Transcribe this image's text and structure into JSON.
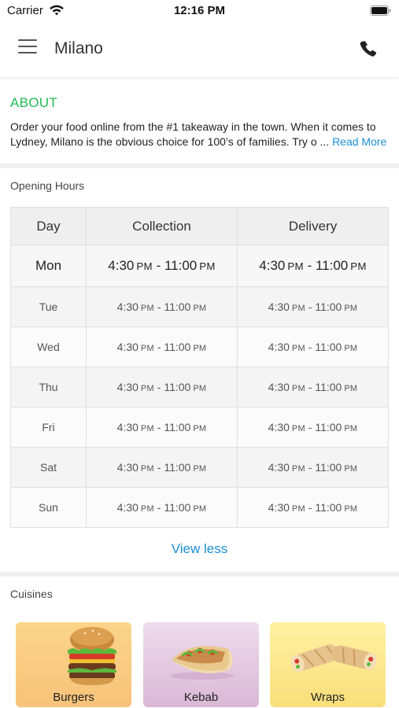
{
  "status_bar": {
    "carrier": "Carrier",
    "time": "12:16 PM",
    "icons": [
      "wifi-icon",
      "battery-icon"
    ]
  },
  "header": {
    "title": "Milano",
    "menu_icon": "hamburger-menu-icon",
    "call_icon": "phone-icon"
  },
  "about": {
    "heading": "ABOUT",
    "text": "Order your food online from the #1 takeaway in the town. When it comes to Lydney, Milano is the obvious choice for 100’s of families. Try o ...",
    "read_more": "Read More"
  },
  "opening_hours": {
    "label": "Opening Hours",
    "columns": [
      "Day",
      "Collection",
      "Delivery"
    ],
    "rows": [
      {
        "day": "Mon",
        "collection": {
          "open": "4:30",
          "open_ampm": "PM",
          "close": "11:00",
          "close_ampm": "PM"
        },
        "delivery": {
          "open": "4:30",
          "open_ampm": "PM",
          "close": "11:00",
          "close_ampm": "PM"
        }
      },
      {
        "day": "Tue",
        "collection": {
          "open": "4:30",
          "open_ampm": "PM",
          "close": "11:00",
          "close_ampm": "PM"
        },
        "delivery": {
          "open": "4:30",
          "open_ampm": "PM",
          "close": "11:00",
          "close_ampm": "PM"
        }
      },
      {
        "day": "Wed",
        "collection": {
          "open": "4:30",
          "open_ampm": "PM",
          "close": "11:00",
          "close_ampm": "PM"
        },
        "delivery": {
          "open": "4:30",
          "open_ampm": "PM",
          "close": "11:00",
          "close_ampm": "PM"
        }
      },
      {
        "day": "Thu",
        "collection": {
          "open": "4:30",
          "open_ampm": "PM",
          "close": "11:00",
          "close_ampm": "PM"
        },
        "delivery": {
          "open": "4:30",
          "open_ampm": "PM",
          "close": "11:00",
          "close_ampm": "PM"
        }
      },
      {
        "day": "Fri",
        "collection": {
          "open": "4:30",
          "open_ampm": "PM",
          "close": "11:00",
          "close_ampm": "PM"
        },
        "delivery": {
          "open": "4:30",
          "open_ampm": "PM",
          "close": "11:00",
          "close_ampm": "PM"
        }
      },
      {
        "day": "Sat",
        "collection": {
          "open": "4:30",
          "open_ampm": "PM",
          "close": "11:00",
          "close_ampm": "PM"
        },
        "delivery": {
          "open": "4:30",
          "open_ampm": "PM",
          "close": "11:00",
          "close_ampm": "PM"
        }
      },
      {
        "day": "Sun",
        "collection": {
          "open": "4:30",
          "open_ampm": "PM",
          "close": "11:00",
          "close_ampm": "PM"
        },
        "delivery": {
          "open": "4:30",
          "open_ampm": "PM",
          "close": "11:00",
          "close_ampm": "PM"
        }
      }
    ],
    "view_less": "View less"
  },
  "cuisines": {
    "label": "Cuisines",
    "items": [
      {
        "name": "Burgers",
        "icon": "burger-image"
      },
      {
        "name": "Kebab",
        "icon": "kebab-image"
      },
      {
        "name": "Wraps",
        "icon": "wraps-image"
      }
    ]
  },
  "colors": {
    "accent_green": "#22bb55",
    "link_blue": "#1a8fd6"
  }
}
